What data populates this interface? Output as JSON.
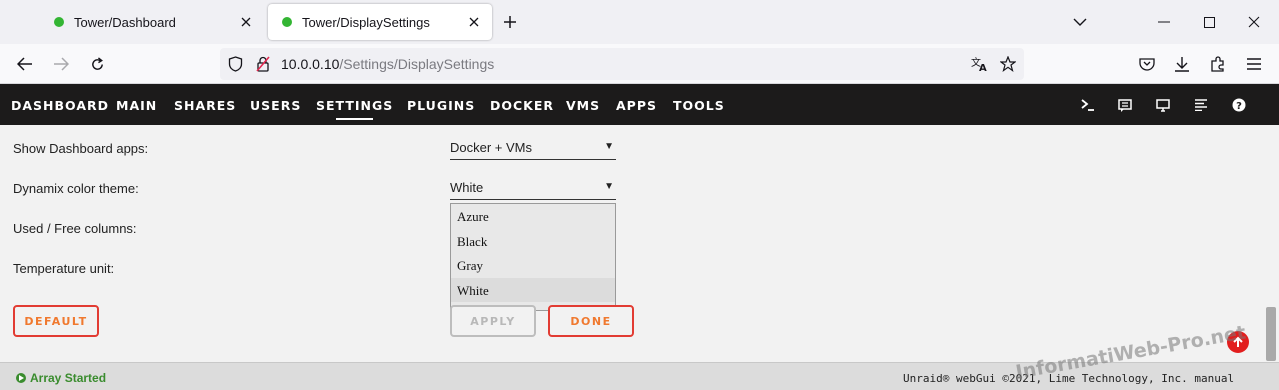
{
  "browser": {
    "tabs": [
      {
        "label": "Tower/Dashboard"
      },
      {
        "label": "Tower/DisplaySettings"
      }
    ],
    "url_host": "10.0.0.10",
    "url_path": "/Settings/DisplaySettings"
  },
  "nav": {
    "items": [
      "DASHBOARD",
      "MAIN",
      "SHARES",
      "USERS",
      "SETTINGS",
      "PLUGINS",
      "DOCKER",
      "VMS",
      "APPS",
      "TOOLS"
    ],
    "active": "SETTINGS"
  },
  "settings": {
    "rows": [
      {
        "label": "Show Dashboard apps:",
        "value": "Docker + VMs"
      },
      {
        "label": "Dynamix color theme:",
        "value": "White"
      },
      {
        "label": "Used / Free columns:"
      },
      {
        "label": "Temperature unit:"
      }
    ],
    "theme_options": [
      "Azure",
      "Black",
      "Gray",
      "White"
    ],
    "theme_selected": "White"
  },
  "buttons": {
    "default": "DEFAULT",
    "apply": "APPLY",
    "done": "DONE"
  },
  "footer": {
    "array_status": "Array Started",
    "copyright": "Unraid® webGui ©2021, Lime Technology, Inc. manual"
  },
  "watermark": "InformatiWeb-Pro.net",
  "colors": {
    "accent_orange": "#f0792f",
    "accent_red": "#e23c33",
    "status_green": "#3a8c2e",
    "header_bg": "#1c1b1b"
  }
}
